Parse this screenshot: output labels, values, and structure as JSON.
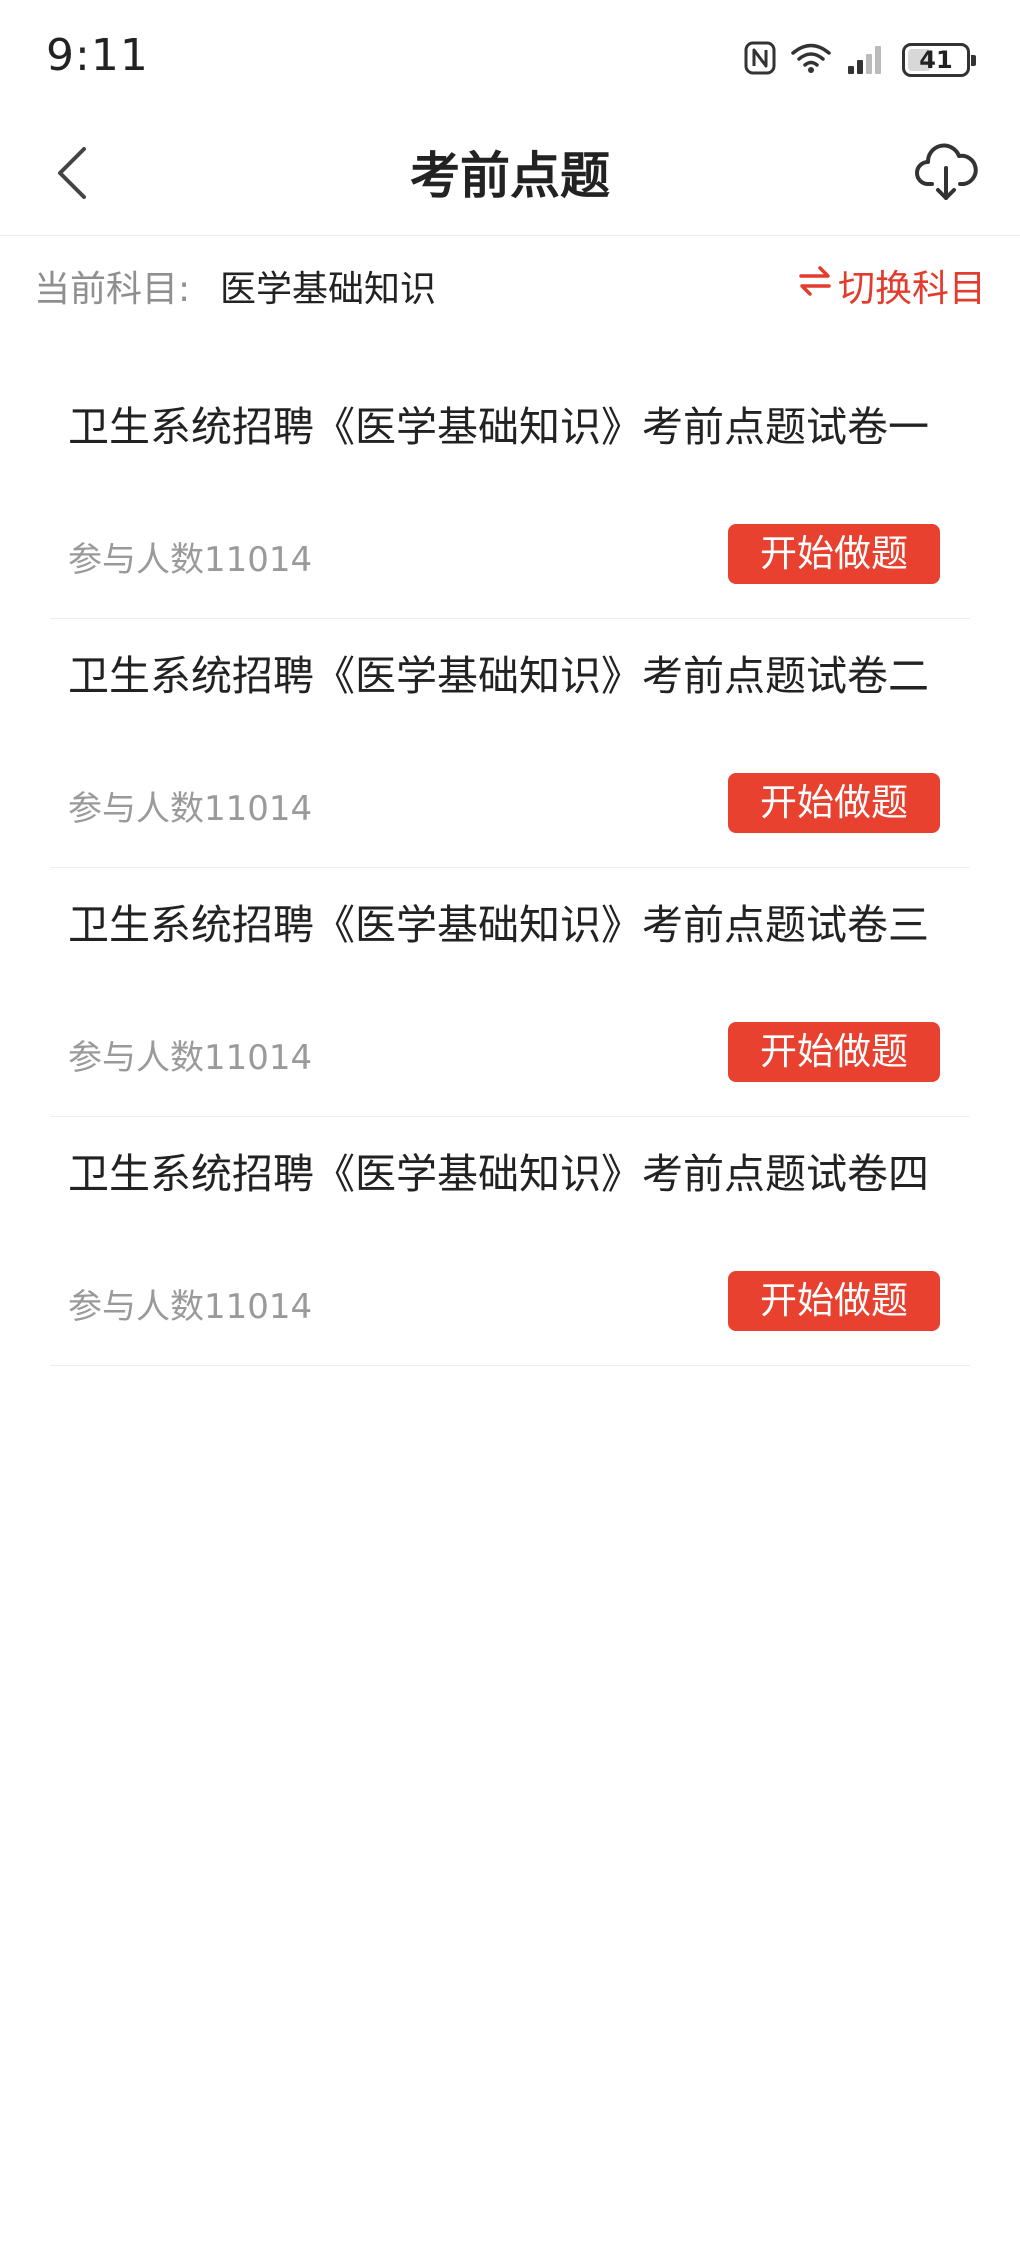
{
  "status_bar": {
    "time": "9:11",
    "battery_level": "41",
    "battery_fraction": 0.41,
    "icons": [
      "nfc-icon",
      "wifi-icon",
      "signal-icon",
      "battery-icon"
    ]
  },
  "nav": {
    "title": "考前点题",
    "back_icon": "chevron-left-icon",
    "download_icon": "cloud-download-icon"
  },
  "subject": {
    "label": "当前科目:",
    "value": "医学基础知识",
    "switch_label": "切换科目",
    "switch_icon": "swap-arrows-icon"
  },
  "papers": [
    {
      "title": "卫生系统招聘《医学基础知识》考前点题试卷一",
      "participants": "参与人数11014",
      "button": "开始做题"
    },
    {
      "title": "卫生系统招聘《医学基础知识》考前点题试卷二",
      "participants": "参与人数11014",
      "button": "开始做题"
    },
    {
      "title": "卫生系统招聘《医学基础知识》考前点题试卷三",
      "participants": "参与人数11014",
      "button": "开始做题"
    },
    {
      "title": "卫生系统招聘《医学基础知识》考前点题试卷四",
      "participants": "参与人数11014",
      "button": "开始做题"
    }
  ],
  "colors": {
    "accent": "#e9412f",
    "accent_text": "#e23c2e",
    "muted_text": "#9a9a9a"
  }
}
